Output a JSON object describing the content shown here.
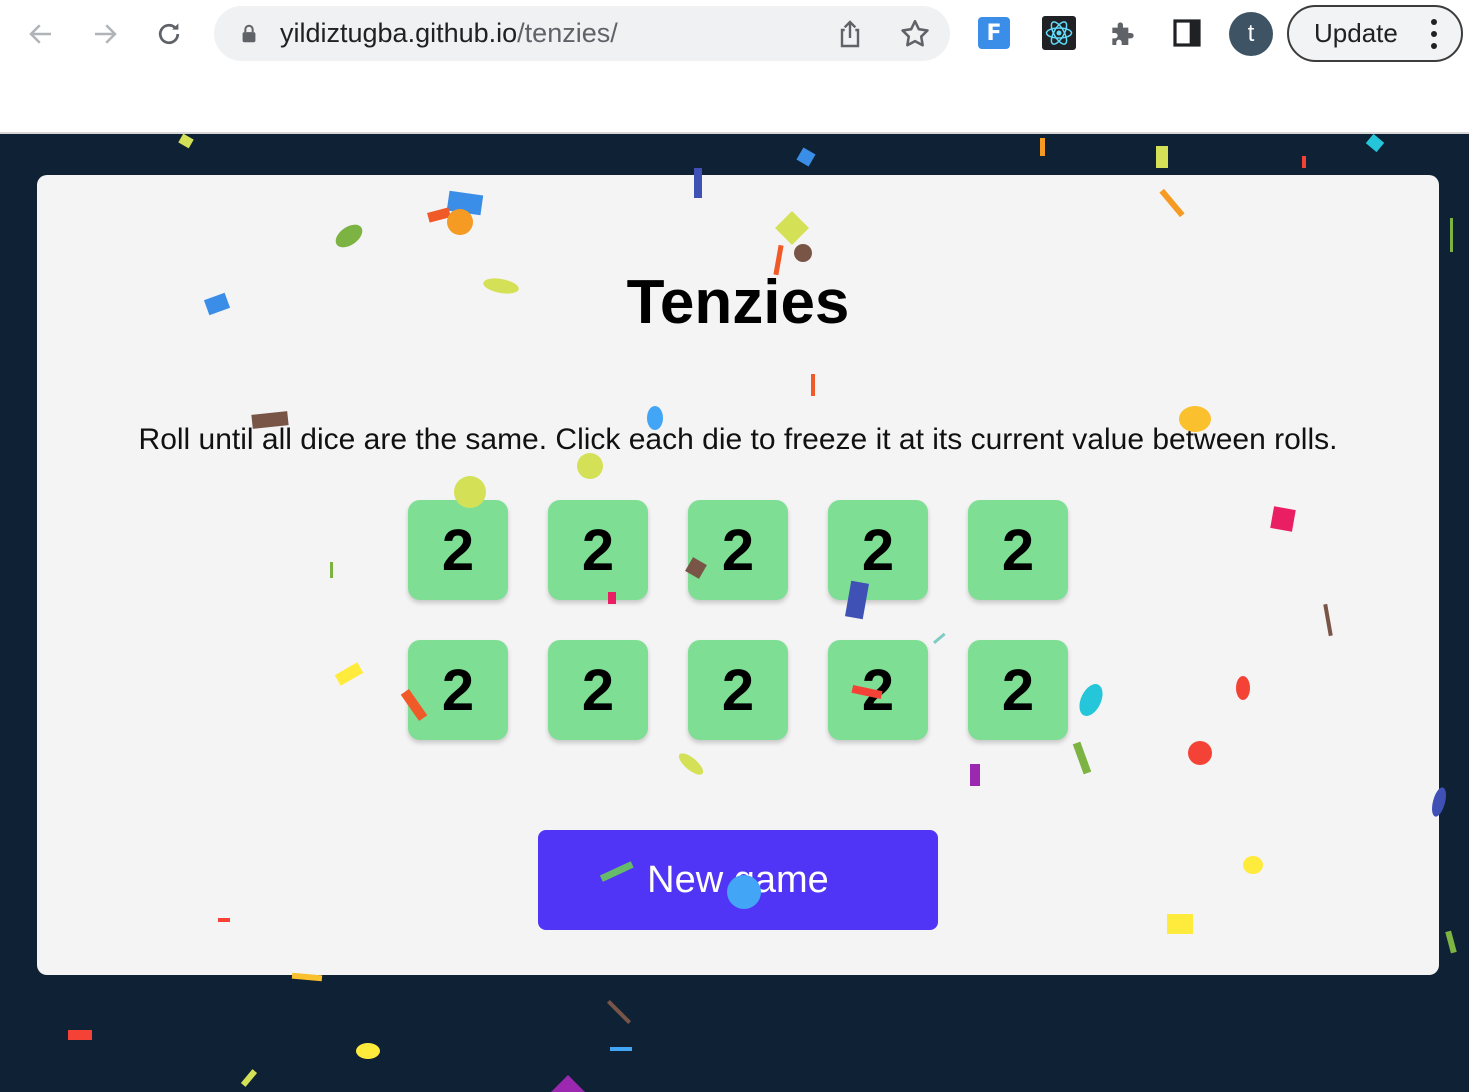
{
  "browser": {
    "url_host": "yildiztugba.github.io",
    "url_path": "/tenzies/",
    "profile_initial": "t",
    "update_label": "Update",
    "extension_f_label": "F"
  },
  "game": {
    "title": "Tenzies",
    "instructions": "Roll until all dice are the same. Click each die to freeze it at its current value between rolls.",
    "dice": [
      "2",
      "2",
      "2",
      "2",
      "2",
      "2",
      "2",
      "2",
      "2",
      "2"
    ],
    "new_game_label": "New game"
  },
  "colors": {
    "page_background": "#0f2235",
    "card_background": "#f4f4f4",
    "die_background": "#7edf94",
    "button_background": "#5035f6"
  }
}
